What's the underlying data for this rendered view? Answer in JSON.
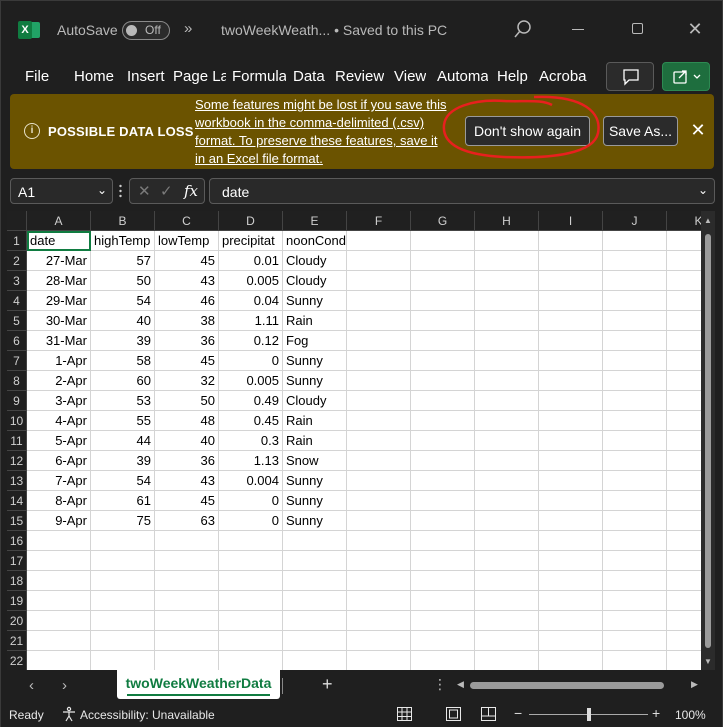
{
  "app": {
    "autosave_label": "AutoSave",
    "autosave_state": "Off",
    "doc_title": "twoWeekWeath...  •  Saved to this PC"
  },
  "ribbon": {
    "tabs": [
      "File",
      "Home",
      "Insert",
      "Page La",
      "Formula",
      "Data",
      "Review",
      "View",
      "Automa",
      "Help",
      "Acroba"
    ]
  },
  "warning": {
    "title": "POSSIBLE DATA LOSS",
    "message": "Some features might be lost if you save this workbook in the comma-delimited (.csv) format. To preserve these features, save it in an Excel file format.",
    "dont_show_label": "Don't show again",
    "save_as_label": "Save As...",
    "accent": "#6b5300",
    "annotation_color": "#e8201e"
  },
  "formula_bar": {
    "name_box": "A1",
    "formula": "date"
  },
  "grid": {
    "columns": [
      "A",
      "B",
      "C",
      "D",
      "E",
      "F",
      "G",
      "H",
      "I",
      "J",
      "K"
    ],
    "row_numbers": [
      "1",
      "2",
      "3",
      "4",
      "5",
      "6",
      "7",
      "8",
      "9",
      "10",
      "11",
      "12",
      "13",
      "14",
      "15",
      "16",
      "17",
      "18",
      "19",
      "20",
      "21",
      "22"
    ],
    "headers": [
      "date",
      "highTemp",
      "lowTemp",
      "precipitat",
      "noonCondition"
    ],
    "rows": [
      [
        "27-Mar",
        "57",
        "45",
        "0.01",
        "Cloudy"
      ],
      [
        "28-Mar",
        "50",
        "43",
        "0.005",
        "Cloudy"
      ],
      [
        "29-Mar",
        "54",
        "46",
        "0.04",
        "Sunny"
      ],
      [
        "30-Mar",
        "40",
        "38",
        "1.11",
        "Rain"
      ],
      [
        "31-Mar",
        "39",
        "36",
        "0.12",
        "Fog"
      ],
      [
        "1-Apr",
        "58",
        "45",
        "0",
        "Sunny"
      ],
      [
        "2-Apr",
        "60",
        "32",
        "0.005",
        "Sunny"
      ],
      [
        "3-Apr",
        "53",
        "50",
        "0.49",
        "Cloudy"
      ],
      [
        "4-Apr",
        "55",
        "48",
        "0.45",
        "Rain"
      ],
      [
        "5-Apr",
        "44",
        "40",
        "0.3",
        "Rain"
      ],
      [
        "6-Apr",
        "39",
        "36",
        "1.13",
        "Snow"
      ],
      [
        "7-Apr",
        "54",
        "43",
        "0.004",
        "Sunny"
      ],
      [
        "8-Apr",
        "61",
        "45",
        "0",
        "Sunny"
      ],
      [
        "9-Apr",
        "75",
        "63",
        "0",
        "Sunny"
      ]
    ]
  },
  "sheet_tabs": {
    "active": "twoWeekWeatherData"
  },
  "status": {
    "ready": "Ready",
    "accessibility": "Accessibility: Unavailable",
    "zoom": "100%"
  },
  "icons": [
    "excel-logo-icon",
    "search-icon",
    "minimize-icon",
    "maximize-icon",
    "close-icon",
    "comment-icon",
    "share-icon",
    "info-icon",
    "accessibility-icon",
    "normal-view-icon",
    "page-layout-icon",
    "page-break-icon"
  ],
  "colors": {
    "excel_green": "#107c41",
    "background": "#1f1f1f"
  }
}
